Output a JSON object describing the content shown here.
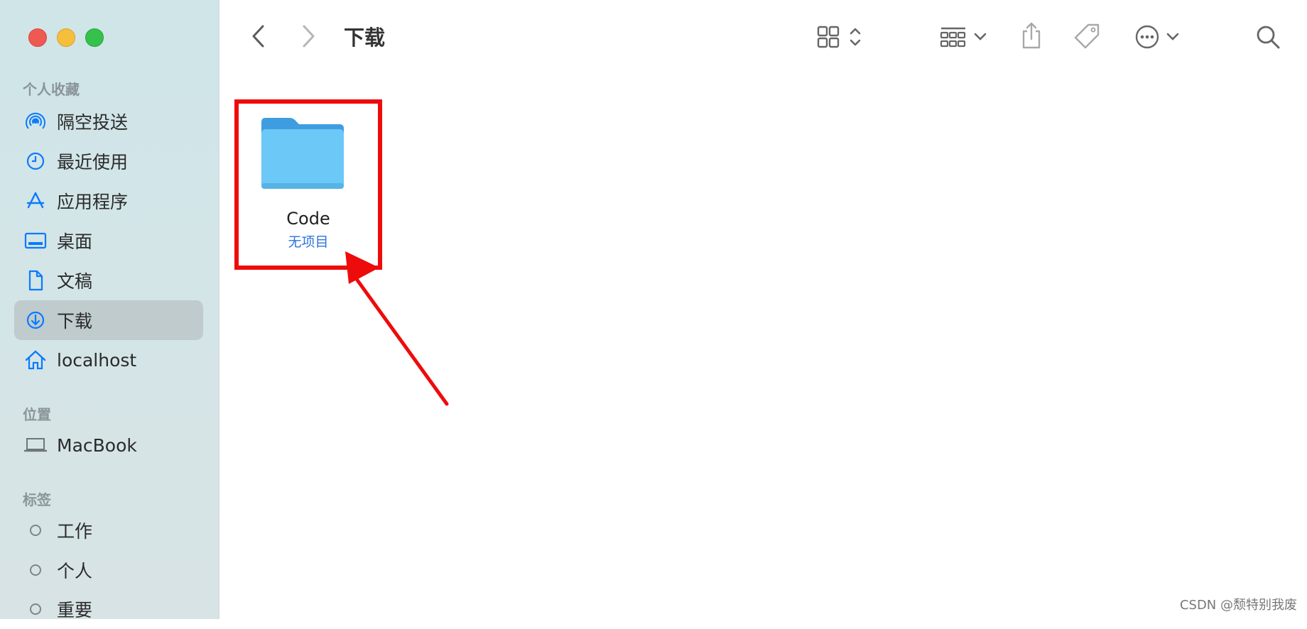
{
  "window": {
    "title": "下载"
  },
  "sidebar": {
    "sections": [
      {
        "title": "个人收藏",
        "items": [
          {
            "label": "隔空投送",
            "icon": "airdrop-icon"
          },
          {
            "label": "最近使用",
            "icon": "clock-icon"
          },
          {
            "label": "应用程序",
            "icon": "app-store-icon"
          },
          {
            "label": "桌面",
            "icon": "desktop-icon"
          },
          {
            "label": "文稿",
            "icon": "document-icon"
          },
          {
            "label": "下载",
            "icon": "download-icon",
            "selected": true
          },
          {
            "label": "localhost",
            "icon": "home-icon"
          }
        ]
      },
      {
        "title": "位置",
        "items": [
          {
            "label": "MacBook",
            "icon": "laptop-icon"
          }
        ]
      },
      {
        "title": "标签",
        "items": [
          {
            "label": "工作",
            "icon": "tag-circle-icon"
          },
          {
            "label": "个人",
            "icon": "tag-circle-icon"
          },
          {
            "label": "重要",
            "icon": "tag-circle-icon"
          }
        ]
      }
    ]
  },
  "toolbar": {
    "icons": [
      "back-icon",
      "forward-icon",
      "grid-view-icon",
      "group-icon",
      "share-icon",
      "tag-icon",
      "more-icon",
      "search-icon"
    ]
  },
  "content": {
    "items": [
      {
        "name": "Code",
        "subtitle": "无项目",
        "icon": "folder-icon"
      }
    ]
  },
  "annotation": {
    "color": "#ee0b0b"
  },
  "watermark": "CSDN @颓特别我废",
  "colors": {
    "accent": "#0a7aff",
    "folder": "#6cc5f3",
    "selection_bg": "#bfcbcd"
  }
}
